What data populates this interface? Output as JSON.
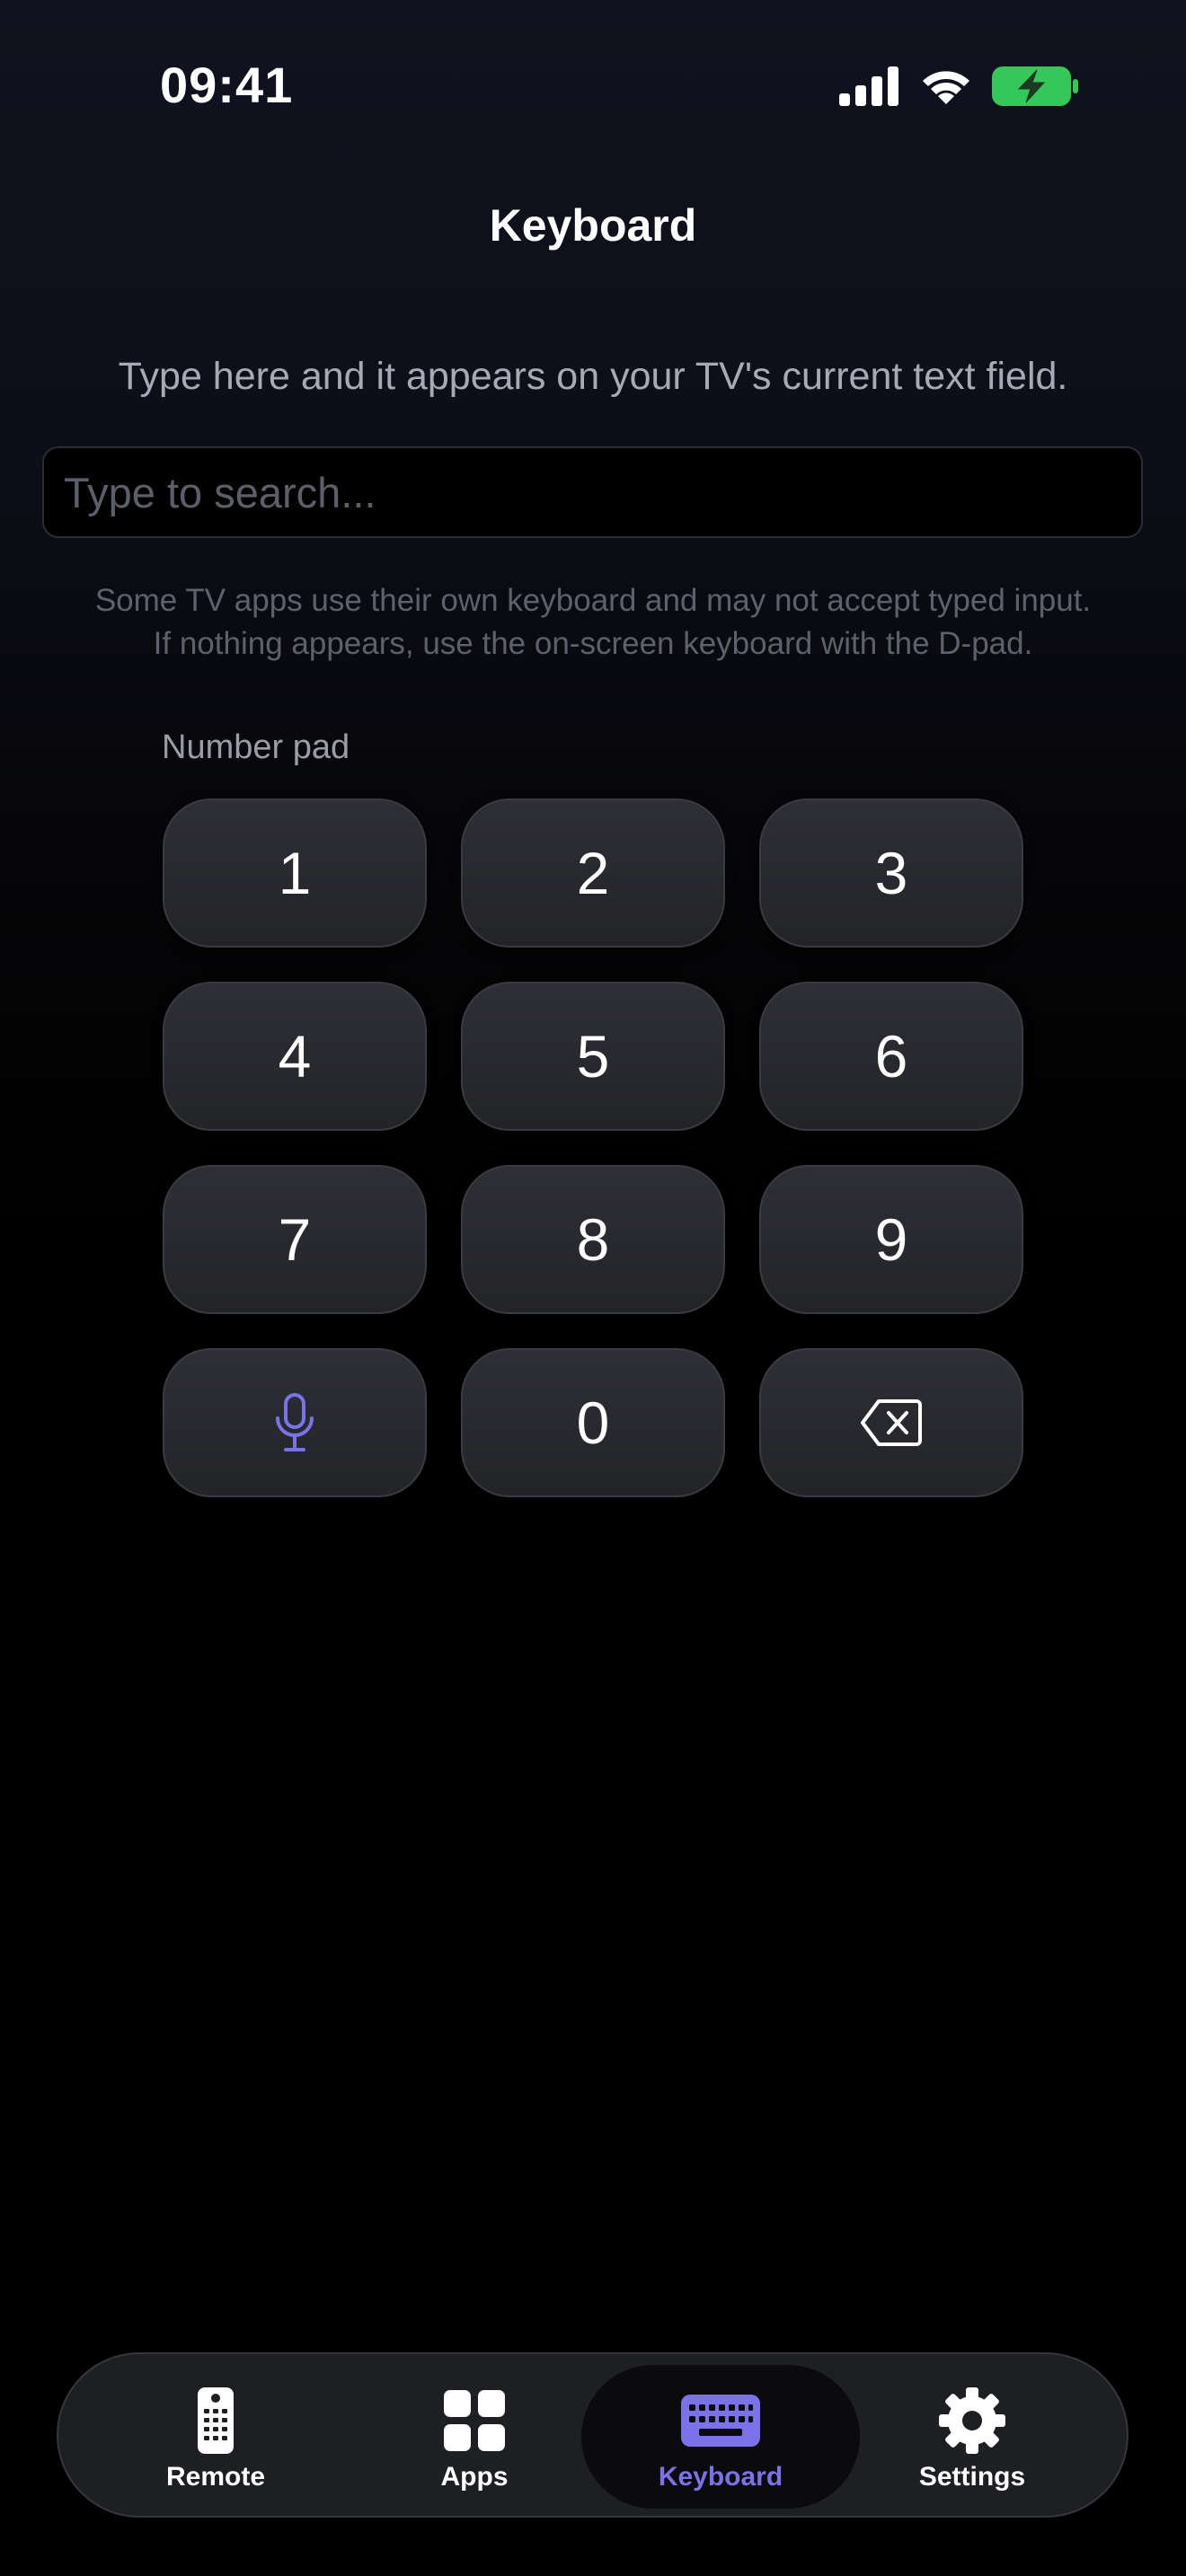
{
  "status_bar": {
    "time": "09:41",
    "icons": [
      "signal-icon",
      "wifi-icon",
      "battery-charging-icon"
    ],
    "battery_color": "#34c759"
  },
  "header": {
    "title": "Keyboard"
  },
  "instruction": "Type here and it appears on your TV's current text field.",
  "search": {
    "placeholder": "Type to search...",
    "value": ""
  },
  "note": {
    "line1": "Some TV apps use their own keyboard and may not accept typed input.",
    "line2": "If nothing appears, use the on-screen keyboard with the D-pad."
  },
  "numpad": {
    "label": "Number pad",
    "keys": [
      "1",
      "2",
      "3",
      "4",
      "5",
      "6",
      "7",
      "8",
      "9",
      "microphone-icon",
      "0",
      "backspace-icon"
    ]
  },
  "tab_bar": {
    "accent": "#7b72e8",
    "tabs": [
      {
        "label": "Remote",
        "icon": "remote-icon",
        "active": false
      },
      {
        "label": "Apps",
        "icon": "apps-grid-icon",
        "active": false
      },
      {
        "label": "Keyboard",
        "icon": "keyboard-icon",
        "active": true
      },
      {
        "label": "Settings",
        "icon": "gear-icon",
        "active": false
      }
    ]
  }
}
